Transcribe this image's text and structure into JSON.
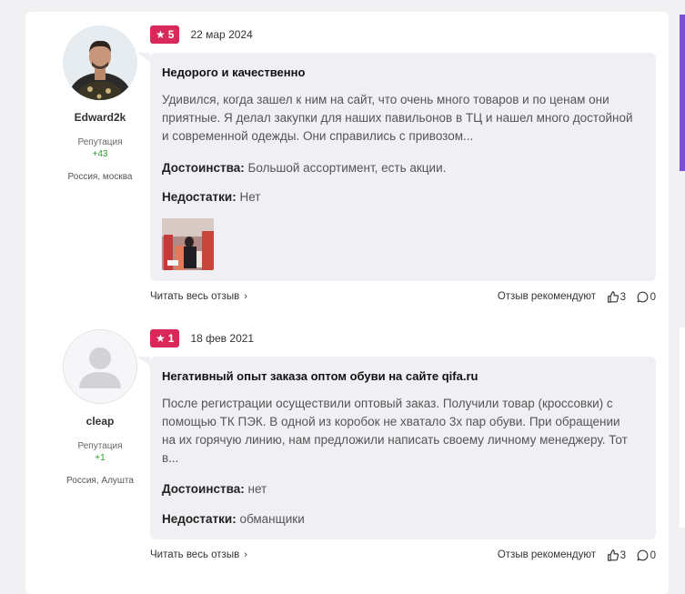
{
  "reviews": [
    {
      "author": {
        "name": "Edward2k",
        "reputation_label": "Репутация",
        "reputation_value": "+43",
        "location": "Россия, москва"
      },
      "rating": "5",
      "date": "22 мар 2024",
      "title": "Недорого и качественно",
      "text": "Удивился, когда зашел к ним на сайт, что очень много товаров и по ценам они приятные. Я делал закупки для наших павильонов в ТЦ и нашел много достойной и современной одежды. Они справились с привозом...",
      "pros_label": "Достоинства:",
      "pros": "Большой ассортимент, есть акции.",
      "cons_label": "Недостатки:",
      "cons": "Нет",
      "read_more": "Читать весь отзыв",
      "recommend_label": "Отзыв рекомендуют",
      "likes": "3",
      "comments": "0"
    },
    {
      "author": {
        "name": "cleap",
        "reputation_label": "Репутация",
        "reputation_value": "+1",
        "location": "Россия, Алушта"
      },
      "rating": "1",
      "date": "18 фев 2021",
      "title": "Негативный опыт заказа оптом обуви на сайте qifa.ru",
      "text": "После регистрации осуществили оптовый заказ. Получили товар (кроссовки) с помощью ТК ПЭК. В одной из коробок не хватало 3х пар обуви. При обращении на их горячую линию, нам предложили написать своему личному менеджеру. Тот в...",
      "pros_label": "Достоинства:",
      "pros": "нет",
      "cons_label": "Недостатки:",
      "cons": "обманщики",
      "read_more": "Читать весь отзыв",
      "recommend_label": "Отзыв рекомендуют",
      "likes": "3",
      "comments": "0"
    }
  ],
  "colors": {
    "rating_badge": "#d8295a",
    "reputation": "#28a028",
    "bubble": "#f0f0f4",
    "accent": "#7a4fd6"
  }
}
